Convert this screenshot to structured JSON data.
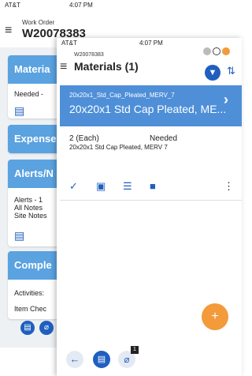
{
  "back_screen": {
    "status": {
      "carrier": "AT&T",
      "time": "4:07 PM"
    },
    "header": {
      "subtitle": "Work Order",
      "title": "W20078383"
    },
    "cards": {
      "materials": {
        "title": "Materia",
        "needed_text": "Needed  -"
      },
      "expenses": {
        "title": "Expense"
      },
      "alerts": {
        "title": "Alerts/N",
        "lines": [
          "Alerts - 1",
          "All Notes",
          "Site Notes"
        ]
      },
      "complete": {
        "title": "Comple",
        "lines": [
          "Activities:",
          "Item Chec"
        ]
      }
    }
  },
  "front_screen": {
    "status": {
      "carrier": "AT&T",
      "time": "4:07 PM"
    },
    "header": {
      "subtitle": "W20078383",
      "title": "Materials (1)"
    },
    "item": {
      "code": "20x20x1_Std_Cap_Pleated_MERV_7",
      "name": "20x20x1 Std Cap Pleated, ME...",
      "quantity": "2 (Each)",
      "status": "Needed",
      "description": "20x20x1 Std Cap Pleated, MERV 7"
    },
    "bottom_nav": {
      "badge_count": "1"
    }
  },
  "colors": {
    "accent": "#1f5fbf",
    "selected_row": "#4f8fd8",
    "card_header": "#5aa2e0",
    "fab": "#f39a3a"
  }
}
